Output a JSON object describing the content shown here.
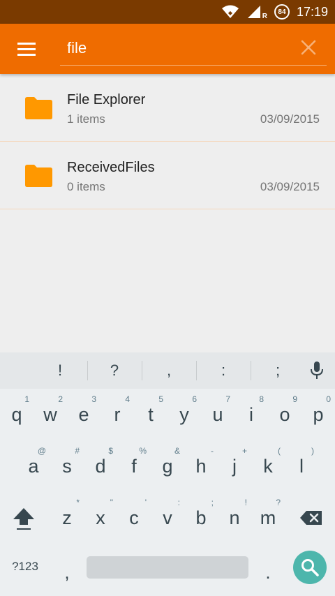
{
  "status_bar": {
    "time": "17:19",
    "battery": "84",
    "network_label": "R",
    "icons": [
      "wifi-icon",
      "signal-icon",
      "battery-icon"
    ]
  },
  "toolbar": {
    "menu_icon": "hamburger-menu-icon",
    "search_value": "file",
    "clear_icon": "close-icon",
    "background": "#ef6c00"
  },
  "results": [
    {
      "name": "File Explorer",
      "count": "1 items",
      "date": "03/09/2015"
    },
    {
      "name": "ReceivedFiles",
      "count": "0 items",
      "date": "03/09/2015"
    }
  ],
  "keyboard": {
    "suggestions": [
      "!",
      "?",
      ",",
      ":",
      ";"
    ],
    "row1": [
      {
        "k": "q",
        "h": "1"
      },
      {
        "k": "w",
        "h": "2"
      },
      {
        "k": "e",
        "h": "3"
      },
      {
        "k": "r",
        "h": "4"
      },
      {
        "k": "t",
        "h": "5"
      },
      {
        "k": "y",
        "h": "6"
      },
      {
        "k": "u",
        "h": "7"
      },
      {
        "k": "i",
        "h": "8"
      },
      {
        "k": "o",
        "h": "9"
      },
      {
        "k": "p",
        "h": "0"
      }
    ],
    "row2": [
      {
        "k": "a",
        "h": "@"
      },
      {
        "k": "s",
        "h": "#"
      },
      {
        "k": "d",
        "h": "$"
      },
      {
        "k": "f",
        "h": "%"
      },
      {
        "k": "g",
        "h": "&"
      },
      {
        "k": "h",
        "h": "-"
      },
      {
        "k": "j",
        "h": "+"
      },
      {
        "k": "k",
        "h": "("
      },
      {
        "k": "l",
        "h": ")"
      }
    ],
    "row3": [
      {
        "k": "z",
        "h": "*"
      },
      {
        "k": "x",
        "h": "\""
      },
      {
        "k": "c",
        "h": "'"
      },
      {
        "k": "v",
        "h": ":"
      },
      {
        "k": "b",
        "h": ";"
      },
      {
        "k": "n",
        "h": "!"
      },
      {
        "k": "m",
        "h": "?"
      }
    ],
    "symbols_label": "?123",
    "comma": ",",
    "period": ".",
    "accent": "#4db6ac"
  }
}
